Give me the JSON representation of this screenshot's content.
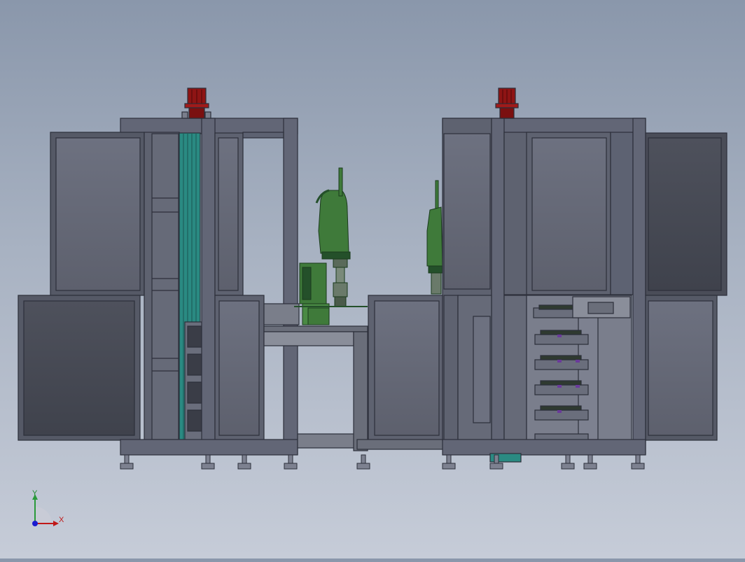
{
  "viewport": {
    "background_top": "#8a97ab",
    "background_bottom": "#c6ccd8"
  },
  "colors": {
    "frame": "#5d6272",
    "frame_edge": "#2c2f3a",
    "panel_light": "#666a78",
    "panel_dark": "#474a55",
    "motor": "#8e1414",
    "robot": "#3f7a3a",
    "robot_dark": "#24502a",
    "rail": "#2a8a82",
    "tray_accent": "#6a3a9a"
  },
  "triad": {
    "y_label": "Y",
    "x_label": "X",
    "icon": "coordinate-axis-triad-icon"
  }
}
